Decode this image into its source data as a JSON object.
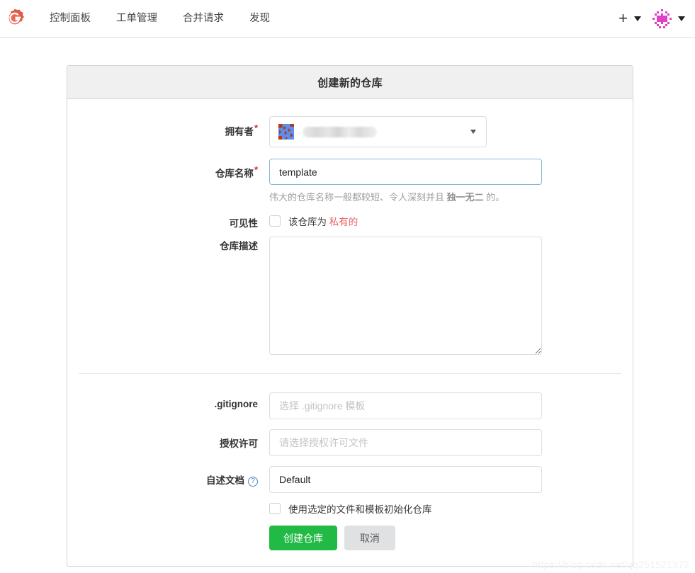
{
  "navbar": {
    "logo_icon": "gitea-logo-icon",
    "links": [
      {
        "label": "控制面板"
      },
      {
        "label": "工单管理"
      },
      {
        "label": "合并请求"
      },
      {
        "label": "发现"
      }
    ],
    "create_icon": "plus-icon",
    "create_caret_icon": "chevron-down-icon",
    "user_avatar_icon": "user-avatar-identicon",
    "user_caret_icon": "chevron-down-icon"
  },
  "card": {
    "title": "创建新的仓库",
    "owner": {
      "label": "拥有者",
      "required_marker": "*",
      "avatar_icon": "owner-avatar-identicon",
      "value": "",
      "caret_icon": "chevron-down-icon"
    },
    "repo_name": {
      "label": "仓库名称",
      "required_marker": "*",
      "value": "template",
      "hint_prefix": "伟大的仓库名称一般都较短、令人深刻并且 ",
      "hint_strong": "独一无二",
      "hint_suffix": " 的。"
    },
    "visibility": {
      "label": "可见性",
      "checkbox_checked": false,
      "text_prefix": "该仓库为 ",
      "text_private": "私有的"
    },
    "description": {
      "label": "仓库描述",
      "value": "",
      "placeholder": ""
    },
    "gitignore": {
      "label": ".gitignore",
      "value": "",
      "placeholder": "选择 .gitignore 模板"
    },
    "license": {
      "label": "授权许可",
      "value": "",
      "placeholder": "请选择授权许可文件"
    },
    "readme": {
      "label": "自述文档",
      "help_icon": "question-circle-icon",
      "value": "Default"
    },
    "init_checkbox": {
      "checked": false,
      "label": "使用选定的文件和模板初始化仓库"
    },
    "buttons": {
      "submit": "创建仓库",
      "cancel": "取消"
    }
  },
  "watermark": "https://blog.csdn.net/qq251521372",
  "colors": {
    "primary_green": "#21ba45",
    "required_red": "#db2828",
    "private_red": "#e8605f",
    "focus_blue": "#85b7d9",
    "logo_red": "#e05d44"
  }
}
